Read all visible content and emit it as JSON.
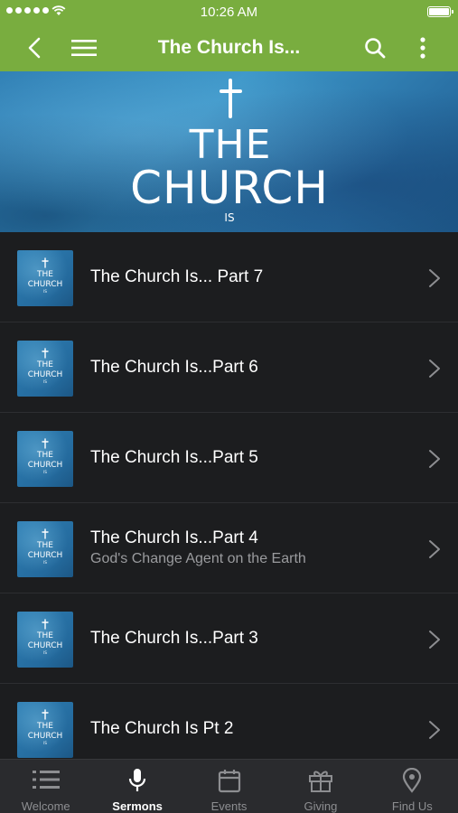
{
  "status_bar": {
    "time": "10:26 AM",
    "signal_icon": "signal-dots-icon",
    "wifi_icon": "wifi-icon",
    "battery_icon": "battery-full-icon"
  },
  "navbar": {
    "title": "The Church Is...",
    "background": "#79ad3f",
    "back_icon": "chevron-left-icon",
    "menu_icon": "hamburger-menu-icon",
    "search_icon": "search-icon",
    "more_icon": "vertical-dots-icon"
  },
  "banner": {
    "line1": "THE",
    "line2": "CHURCH",
    "line3": "IS"
  },
  "thumb_art": {
    "line1": "THE",
    "line2": "CHURCH",
    "line3": "IS"
  },
  "sermons": [
    {
      "title": "The Church Is... Part 7",
      "subtitle": ""
    },
    {
      "title": "The Church Is...Part 6",
      "subtitle": ""
    },
    {
      "title": "The Church Is...Part 5",
      "subtitle": ""
    },
    {
      "title": "The Church Is...Part 4",
      "subtitle": "God's Change Agent on the Earth"
    },
    {
      "title": "The Church Is...Part 3",
      "subtitle": ""
    },
    {
      "title": "The Church Is Pt 2",
      "subtitle": ""
    }
  ],
  "tabs": [
    {
      "label": "Welcome",
      "icon": "list-icon",
      "active": false
    },
    {
      "label": "Sermons",
      "icon": "microphone-icon",
      "active": true
    },
    {
      "label": "Events",
      "icon": "calendar-icon",
      "active": false
    },
    {
      "label": "Giving",
      "icon": "gift-icon",
      "active": false
    },
    {
      "label": "Find Us",
      "icon": "map-pin-icon",
      "active": false
    }
  ]
}
